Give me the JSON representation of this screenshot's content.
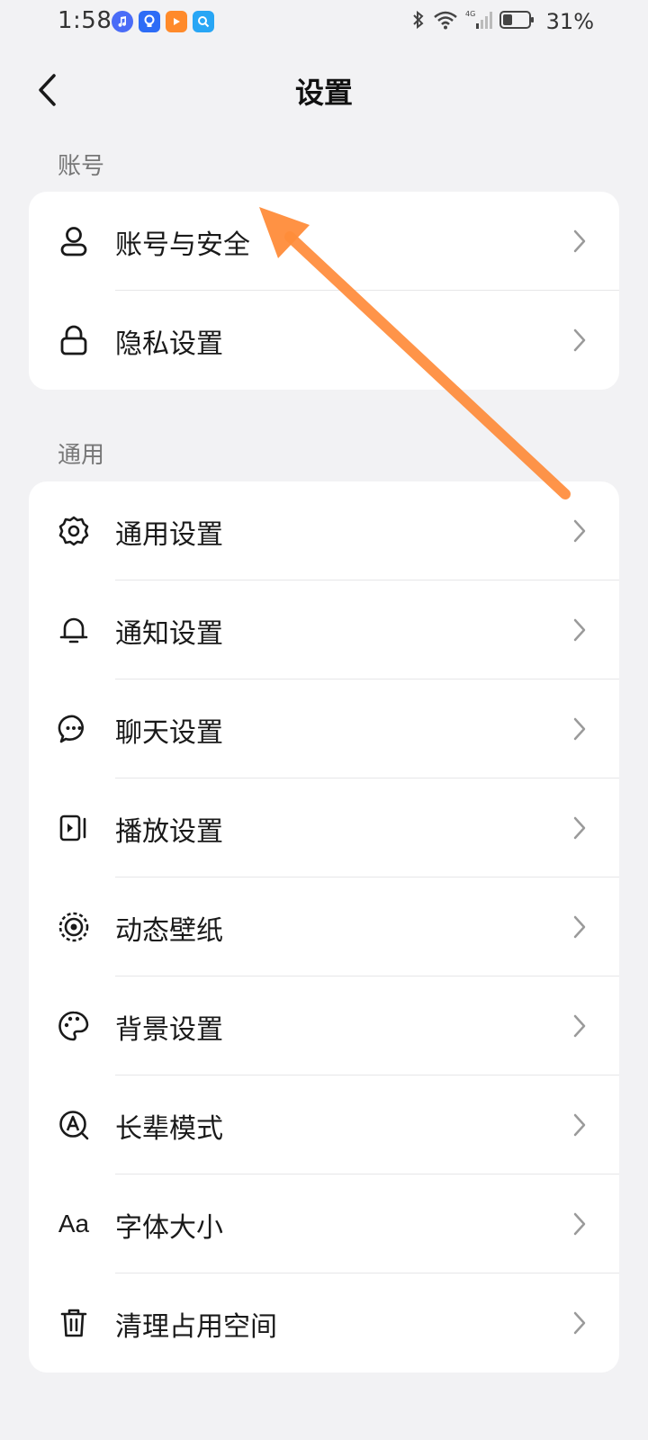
{
  "status_bar": {
    "time": "1:58",
    "battery_percent": "31%",
    "network": "4G",
    "app_icons": [
      "music-icon",
      "bulb-app-icon",
      "video-app-icon",
      "search-app-icon"
    ]
  },
  "header": {
    "title": "设置"
  },
  "sections": [
    {
      "label": "账号",
      "items": [
        {
          "label": "账号与安全",
          "icon": "user-icon"
        },
        {
          "label": "隐私设置",
          "icon": "lock-icon"
        }
      ]
    },
    {
      "label": "通用",
      "items": [
        {
          "label": "通用设置",
          "icon": "gear-icon"
        },
        {
          "label": "通知设置",
          "icon": "bell-icon"
        },
        {
          "label": "聊天设置",
          "icon": "chat-bubble-icon"
        },
        {
          "label": "播放设置",
          "icon": "play-icon"
        },
        {
          "label": "动态壁纸",
          "icon": "live-wallpaper-icon"
        },
        {
          "label": "背景设置",
          "icon": "palette-icon"
        },
        {
          "label": "长辈模式",
          "icon": "elder-mode-icon"
        },
        {
          "label": "字体大小",
          "icon": "font-size-icon",
          "glyph": "Aa"
        },
        {
          "label": "清理占用空间",
          "icon": "trash-icon"
        }
      ]
    }
  ],
  "colors": {
    "background": "#f2f2f4",
    "card": "#ffffff",
    "annotation_arrow": "#ff8c3a"
  }
}
